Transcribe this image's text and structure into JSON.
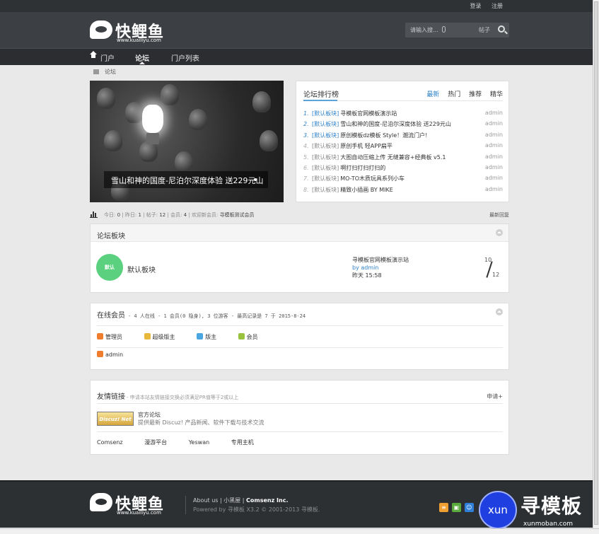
{
  "topbar": {
    "login": "登录",
    "register": "注册"
  },
  "logo": {
    "name": "快鲤鱼",
    "url": "www.kuailiyu.com"
  },
  "search": {
    "placeholder": "请输入搜...",
    "type": "帖子"
  },
  "nav": {
    "items": [
      "门户",
      "论坛",
      "门户列表"
    ],
    "active": 1
  },
  "breadcrumb": {
    "current": "论坛"
  },
  "slide": {
    "caption": "雪山和神的国度-尼泊尔深度体验 送229元山"
  },
  "ranking": {
    "title": "论坛排行榜",
    "tabs": [
      "最新",
      "热门",
      "推荐",
      "精华"
    ],
    "items": [
      {
        "num": "1.",
        "cat": "[默认板块]",
        "title": "寻模板官网模板演示站",
        "author": "admin"
      },
      {
        "num": "2.",
        "cat": "[默认板块]",
        "title": "雪山和神的国度-尼泊尔深度体验 送229元山",
        "author": "admin"
      },
      {
        "num": "3.",
        "cat": "[默认板块]",
        "title": "原创模板dz模板 Style！潮流门户!",
        "author": "admin"
      },
      {
        "num": "4.",
        "cat": "[默认板块]",
        "title": "原创手机 轻APP扁平",
        "author": "admin"
      },
      {
        "num": "5.",
        "cat": "[默认板块]",
        "title": "大图自动压缩上传 无缝兼容+经典板 v5.1",
        "author": "admin"
      },
      {
        "num": "6.",
        "cat": "[默认板块]",
        "title": "啊打扫打扫打扫的",
        "author": "admin"
      },
      {
        "num": "7.",
        "cat": "[默认板块]",
        "title": "MO-TO木质玩具系列小车",
        "author": "admin"
      },
      {
        "num": "8.",
        "cat": "[默认板块]",
        "title": "精致小插画 BY MIKE",
        "author": "admin"
      }
    ]
  },
  "stats": {
    "today_label": "今日:",
    "today": "0",
    "yesterday_label": "昨日:",
    "yesterday": "1",
    "posts_label": "帖子:",
    "posts": "12",
    "members_label": "会员:",
    "members": "4",
    "welcome": "欢迎新会员:",
    "newest": "寻模板测试会员",
    "latest_reply": "最新回复"
  },
  "forum_block": {
    "title": "论坛板块",
    "forum": {
      "icon_text": "默认",
      "name": "默认板块",
      "last_title": "寻模板官网模板演示站",
      "by": "by",
      "last_author": "admin",
      "last_time": "昨天 15:58",
      "threads": "10",
      "posts": "12"
    }
  },
  "online": {
    "title": "在线会员",
    "summary": "- 4 人在线 - 1 会员(0 隐身), 3 位游客 - 最高记录是 7 于 2015-8-24",
    "legend": [
      {
        "label": "管理员",
        "color": "#f07d2e"
      },
      {
        "label": "超级版主",
        "color": "#e8b83a"
      },
      {
        "label": "版主",
        "color": "#4aa6e0"
      },
      {
        "label": "会员",
        "color": "#9ac33d"
      }
    ],
    "member": "admin",
    "member_color": "#f07d2e"
  },
  "links": {
    "title": "友情链接",
    "subtitle": "- 申请本站友情链接交换必须满足PR值等于2或以上",
    "apply": "申请+",
    "logo_text": "Discuz! Net",
    "feature_name": "官方论坛",
    "feature_desc": "提供最新 Discuz! 产品新闻、软件下载与技术交流",
    "text_links": [
      "Comsenz",
      "漫游平台",
      "Yeswan",
      "专用主机"
    ]
  },
  "footer": {
    "about": "About us",
    "sep1": "|",
    "house": "小黑屋",
    "sep2": "|",
    "company": "Comsenz Inc.",
    "powered": "Powered by 寻模板 X3.2 © 2001-2013 寻模板."
  },
  "watermark": {
    "circle": "xun",
    "text": "寻模板",
    "url": "xunmoban.com"
  }
}
